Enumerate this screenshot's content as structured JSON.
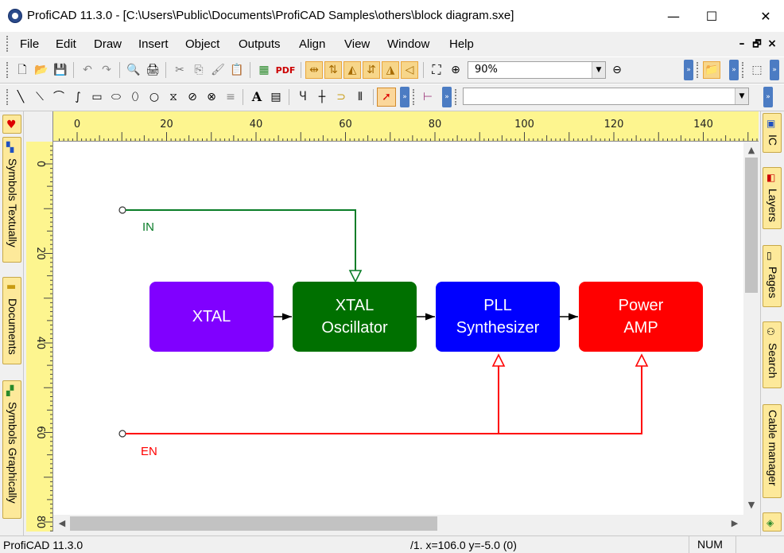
{
  "window": {
    "title": "ProfiCAD 11.3.0 - [C:\\Users\\Public\\Documents\\ProfiCAD Samples\\others\\block diagram.sxe]",
    "minimize": "—",
    "maximize": "☐",
    "close": "✕"
  },
  "menu": {
    "items": [
      "File",
      "Edit",
      "Draw",
      "Insert",
      "Object",
      "Outputs",
      "Align",
      "View",
      "Window",
      "Help"
    ],
    "mdi_minimize": "–",
    "mdi_restore": "🗗",
    "mdi_close": "×"
  },
  "toolbar": {
    "zoom_value": "90%",
    "pdf_label": "PDF",
    "object_combo_value": ""
  },
  "left_tabs": {
    "symbols_textually": "Symbols Textually",
    "documents": "Documents",
    "symbols_graphically": "Symbols Graphically"
  },
  "right_tabs": {
    "ic": "IC",
    "layers": "Layers",
    "pages": "Pages",
    "search": "Search",
    "cable_manager": "Cable manager"
  },
  "ruler": {
    "h_labels": [
      "0",
      "20",
      "40",
      "60",
      "80",
      "100",
      "120",
      "140"
    ],
    "v_labels": [
      "0",
      "20",
      "40",
      "60",
      "80"
    ]
  },
  "diagram": {
    "blocks": [
      {
        "line1": "XTAL",
        "line2": "",
        "color": "#8000ff"
      },
      {
        "line1": "XTAL",
        "line2": "Oscillator",
        "color": "#007000"
      },
      {
        "line1": "PLL",
        "line2": "Synthesizer",
        "color": "#0000ff"
      },
      {
        "line1": "Power",
        "line2": "AMP",
        "color": "#ff0000"
      }
    ],
    "in_label": "IN",
    "en_label": "EN",
    "in_color": "#0a7d28",
    "en_color": "#ff0000"
  },
  "status": {
    "app": "ProfiCAD 11.3.0",
    "coords": "/1.  x=106.0  y=-5.0 (0)",
    "num": "NUM"
  }
}
